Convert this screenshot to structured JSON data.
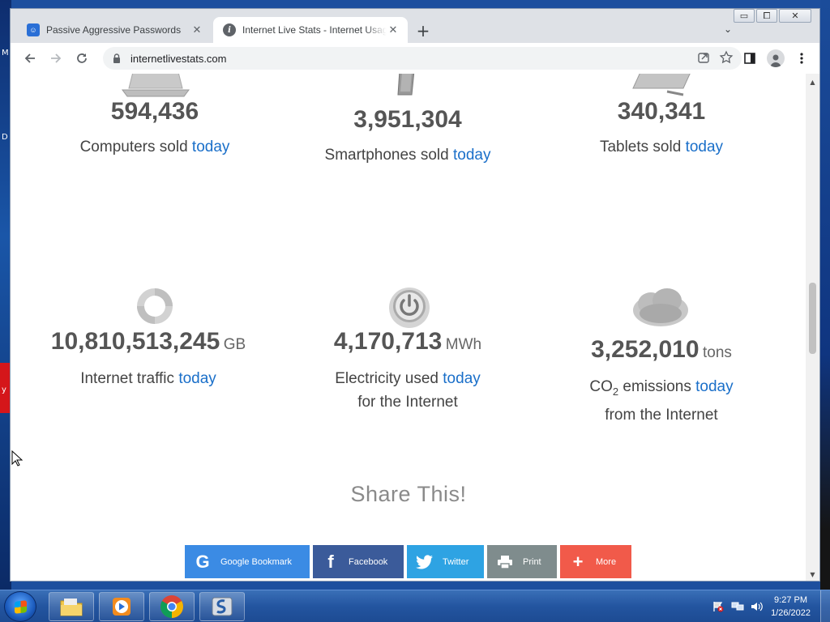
{
  "desktop": {
    "left_letters": [
      "M",
      "D",
      "y"
    ]
  },
  "window": {
    "controls": {
      "minimize": "▭",
      "maximize": "⧠",
      "close": "✕"
    },
    "tabs": [
      {
        "title": "Passive Aggressive Passwords",
        "icon": "pap-favicon",
        "active": false
      },
      {
        "title": "Internet Live Stats - Internet Usage",
        "icon": "info-favicon",
        "active": true
      }
    ],
    "new_tab": "+",
    "tab_search": "⌄",
    "url": "internetlivestats.com"
  },
  "stats": [
    {
      "value": "594,436",
      "unit": "",
      "label": "Computers sold",
      "link": "today",
      "icon": "laptop-icon"
    },
    {
      "value": "3,951,304",
      "unit": "",
      "label": "Smartphones sold",
      "link": "today",
      "icon": "smartphone-icon"
    },
    {
      "value": "340,341",
      "unit": "",
      "label": "Tablets sold",
      "link": "today",
      "icon": "tablet-icon"
    },
    {
      "value": "10,810,513,245",
      "unit": "GB",
      "label": "Internet traffic",
      "link": "today",
      "icon": "traffic-cycle-icon"
    },
    {
      "value": "4,170,713",
      "unit": "MWh",
      "label": "Electricity used",
      "link": "today",
      "label2": "for the Internet",
      "icon": "power-icon"
    },
    {
      "value": "3,252,010",
      "unit": "tons",
      "label_prefix": "CO",
      "label_sub": "2",
      "label": "emissions",
      "link": "today",
      "label2": "from the Internet",
      "icon": "cloud-icon"
    }
  ],
  "share": {
    "title": "Share This!",
    "buttons": [
      {
        "label": "Google Bookmark",
        "glyph": "G",
        "icon": "google-icon",
        "color": "#3b8be4"
      },
      {
        "label": "Facebook",
        "glyph": "f",
        "icon": "facebook-icon",
        "color": "#3b5b9a"
      },
      {
        "label": "Twitter",
        "glyph": "",
        "icon": "twitter-icon",
        "color": "#2ea3e3"
      },
      {
        "label": "Print",
        "glyph": "",
        "icon": "printer-icon",
        "color": "#7f8c8d"
      },
      {
        "label": "More",
        "glyph": "+",
        "icon": "plus-icon",
        "color": "#f15a4a"
      }
    ]
  },
  "taskbar": {
    "time": "9:27 PM",
    "date": "1/26/2022",
    "apps": [
      "file-explorer",
      "media-player",
      "chrome",
      "snagit"
    ]
  }
}
